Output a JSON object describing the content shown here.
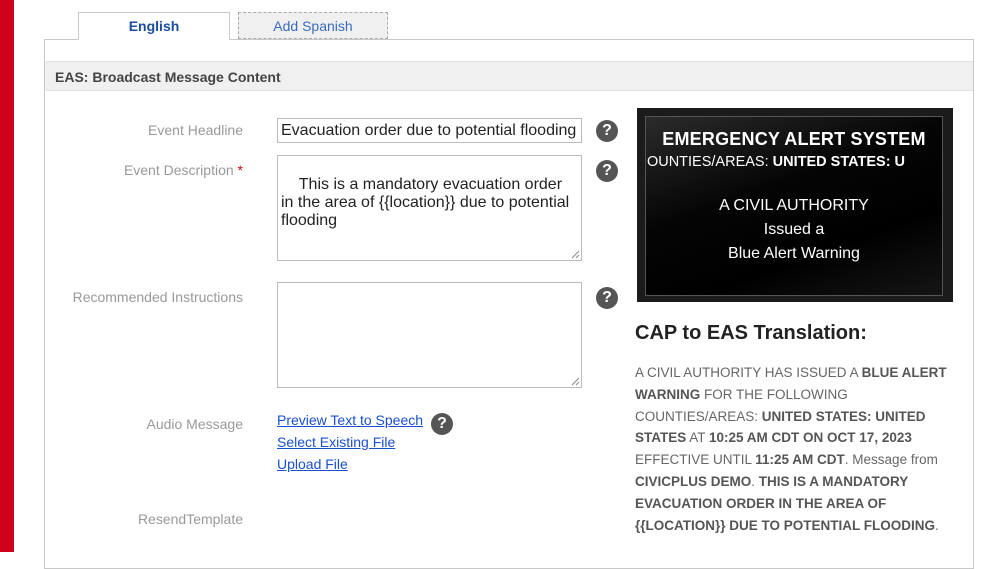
{
  "tabs": {
    "english": "English",
    "add_spanish": "Add Spanish"
  },
  "section_header": "EAS: Broadcast Message Content",
  "form": {
    "event_headline_label": "Event Headline",
    "event_headline_value": "Evacuation order due to potential flooding",
    "event_description_label": "Event Description",
    "required_mark": "*",
    "event_description_value": "This is a mandatory evacuation order in the area of {{location}} due to potential flooding",
    "recommended_instructions_label": "Recommended Instructions",
    "recommended_instructions_value": "",
    "audio_message_label": "Audio Message",
    "preview_link": "Preview Text to Speech",
    "select_link": "Select Existing File",
    "upload_link": "Upload File",
    "resend_label": "ResendTemplate",
    "help_glyph": "?"
  },
  "eas_preview": {
    "title": "EMERGENCY ALERT SYSTEM",
    "scroll_prefix": "OUNTIES/AREAS: ",
    "scroll_bold": "UNITED STATES: U",
    "line1": "A CIVIL AUTHORITY",
    "line2": "Issued a",
    "line3": "Blue Alert Warning"
  },
  "cap": {
    "title": "CAP to EAS Translation:",
    "t1": "A CIVIL AUTHORITY HAS ISSUED A ",
    "b1": "BLUE ALERT WARNING",
    "t2": " FOR THE FOLLOWING COUNTIES/AREAS: ",
    "b2": "UNITED STATES: UNITED STATES",
    "t3": " AT ",
    "b3": "10:25 AM CDT ON OCT 17, 2023",
    "t4": " EFFECTIVE UNTIL ",
    "b4": "11:25 AM CDT",
    "t5": ". Message from ",
    "b5": "CIVICPLUS DEMO",
    "t6": ". ",
    "b6": "THIS IS A MANDATORY EVACUATION ORDER IN THE AREA OF {{LOCATION}} DUE TO POTENTIAL FLOODING",
    "t7": "."
  },
  "colors": {
    "accent_red": "#d0011b",
    "link_blue": "#1a4fd0",
    "tab_blue": "#1a4fa0"
  },
  "icons": {
    "help": "help-circle-icon",
    "resize": "resize-grip-icon"
  }
}
